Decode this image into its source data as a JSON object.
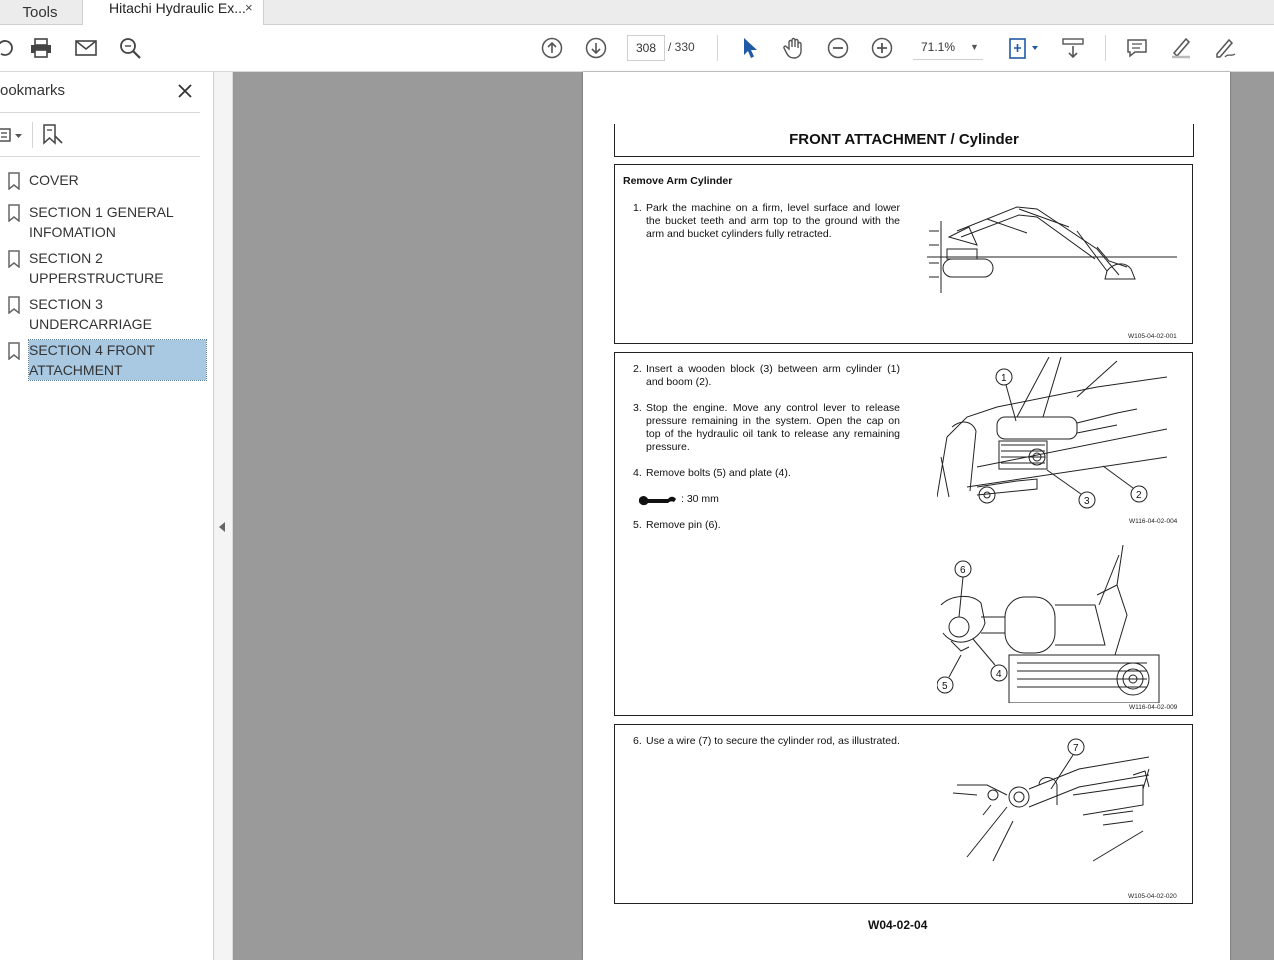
{
  "tabs": {
    "tools": "Tools",
    "document": "Hitachi Hydraulic Ex...",
    "close": "×"
  },
  "toolbar": {
    "page_current": "308",
    "page_total": "/  330",
    "zoom": "71.1%",
    "icons": [
      "save-icon",
      "print-icon",
      "email-icon",
      "search-icon",
      "page-up-icon",
      "page-down-icon",
      "select-cursor-icon",
      "hand-tool-icon",
      "zoom-out-icon",
      "zoom-in-icon",
      "fit-page-icon",
      "scroll-mode-icon",
      "comment-icon",
      "highlight-icon",
      "sign-icon"
    ]
  },
  "sidebar": {
    "title": "ookmarks",
    "items": [
      {
        "label": "COVER"
      },
      {
        "label": "SECTION 1 GENERAL INFOMATION"
      },
      {
        "label": "SECTION 2 UPPERSTRUCTURE"
      },
      {
        "label": "SECTION 3 UNDERCARRIAGE"
      },
      {
        "label": "SECTION 4 FRONT ATTACHMENT"
      }
    ],
    "selected_index": 4
  },
  "document": {
    "header": "FRONT ATTACHMENT / Cylinder",
    "panel1": {
      "title": "Remove Arm Cylinder",
      "step1_num": "1.",
      "step1": "Park the machine on a firm, level surface and lower the bucket teeth and arm top to the ground with the arm and bucket cylinders fully retracted.",
      "fig": "W105-04-02-001"
    },
    "panel2": {
      "step2_num": "2.",
      "step2": "Insert a wooden block (3) between arm cylinder (1) and boom (2).",
      "step3_num": "3.",
      "step3": "Stop the engine. Move any control lever to release pressure remaining in the system. Open the cap on top of the hydraulic oil tank to release any remaining pressure.",
      "step4_num": "4.",
      "step4": "Remove bolts (5) and plate (4).",
      "wrench": ": 30  mm",
      "step5_num": "5.",
      "step5": "Remove pin (6).",
      "fig_a": "W116-04-02-004",
      "fig_b": "W116-04-02-009",
      "callouts_a": [
        "1",
        "2",
        "3"
      ],
      "callouts_b": [
        "6",
        "4",
        "5"
      ]
    },
    "panel3": {
      "step6_num": "6.",
      "step6": "Use a wire (7) to secure the cylinder rod, as illustrated.",
      "callout": "7",
      "fig": "W105-04-02-020"
    },
    "footer": "W04-02-04"
  }
}
